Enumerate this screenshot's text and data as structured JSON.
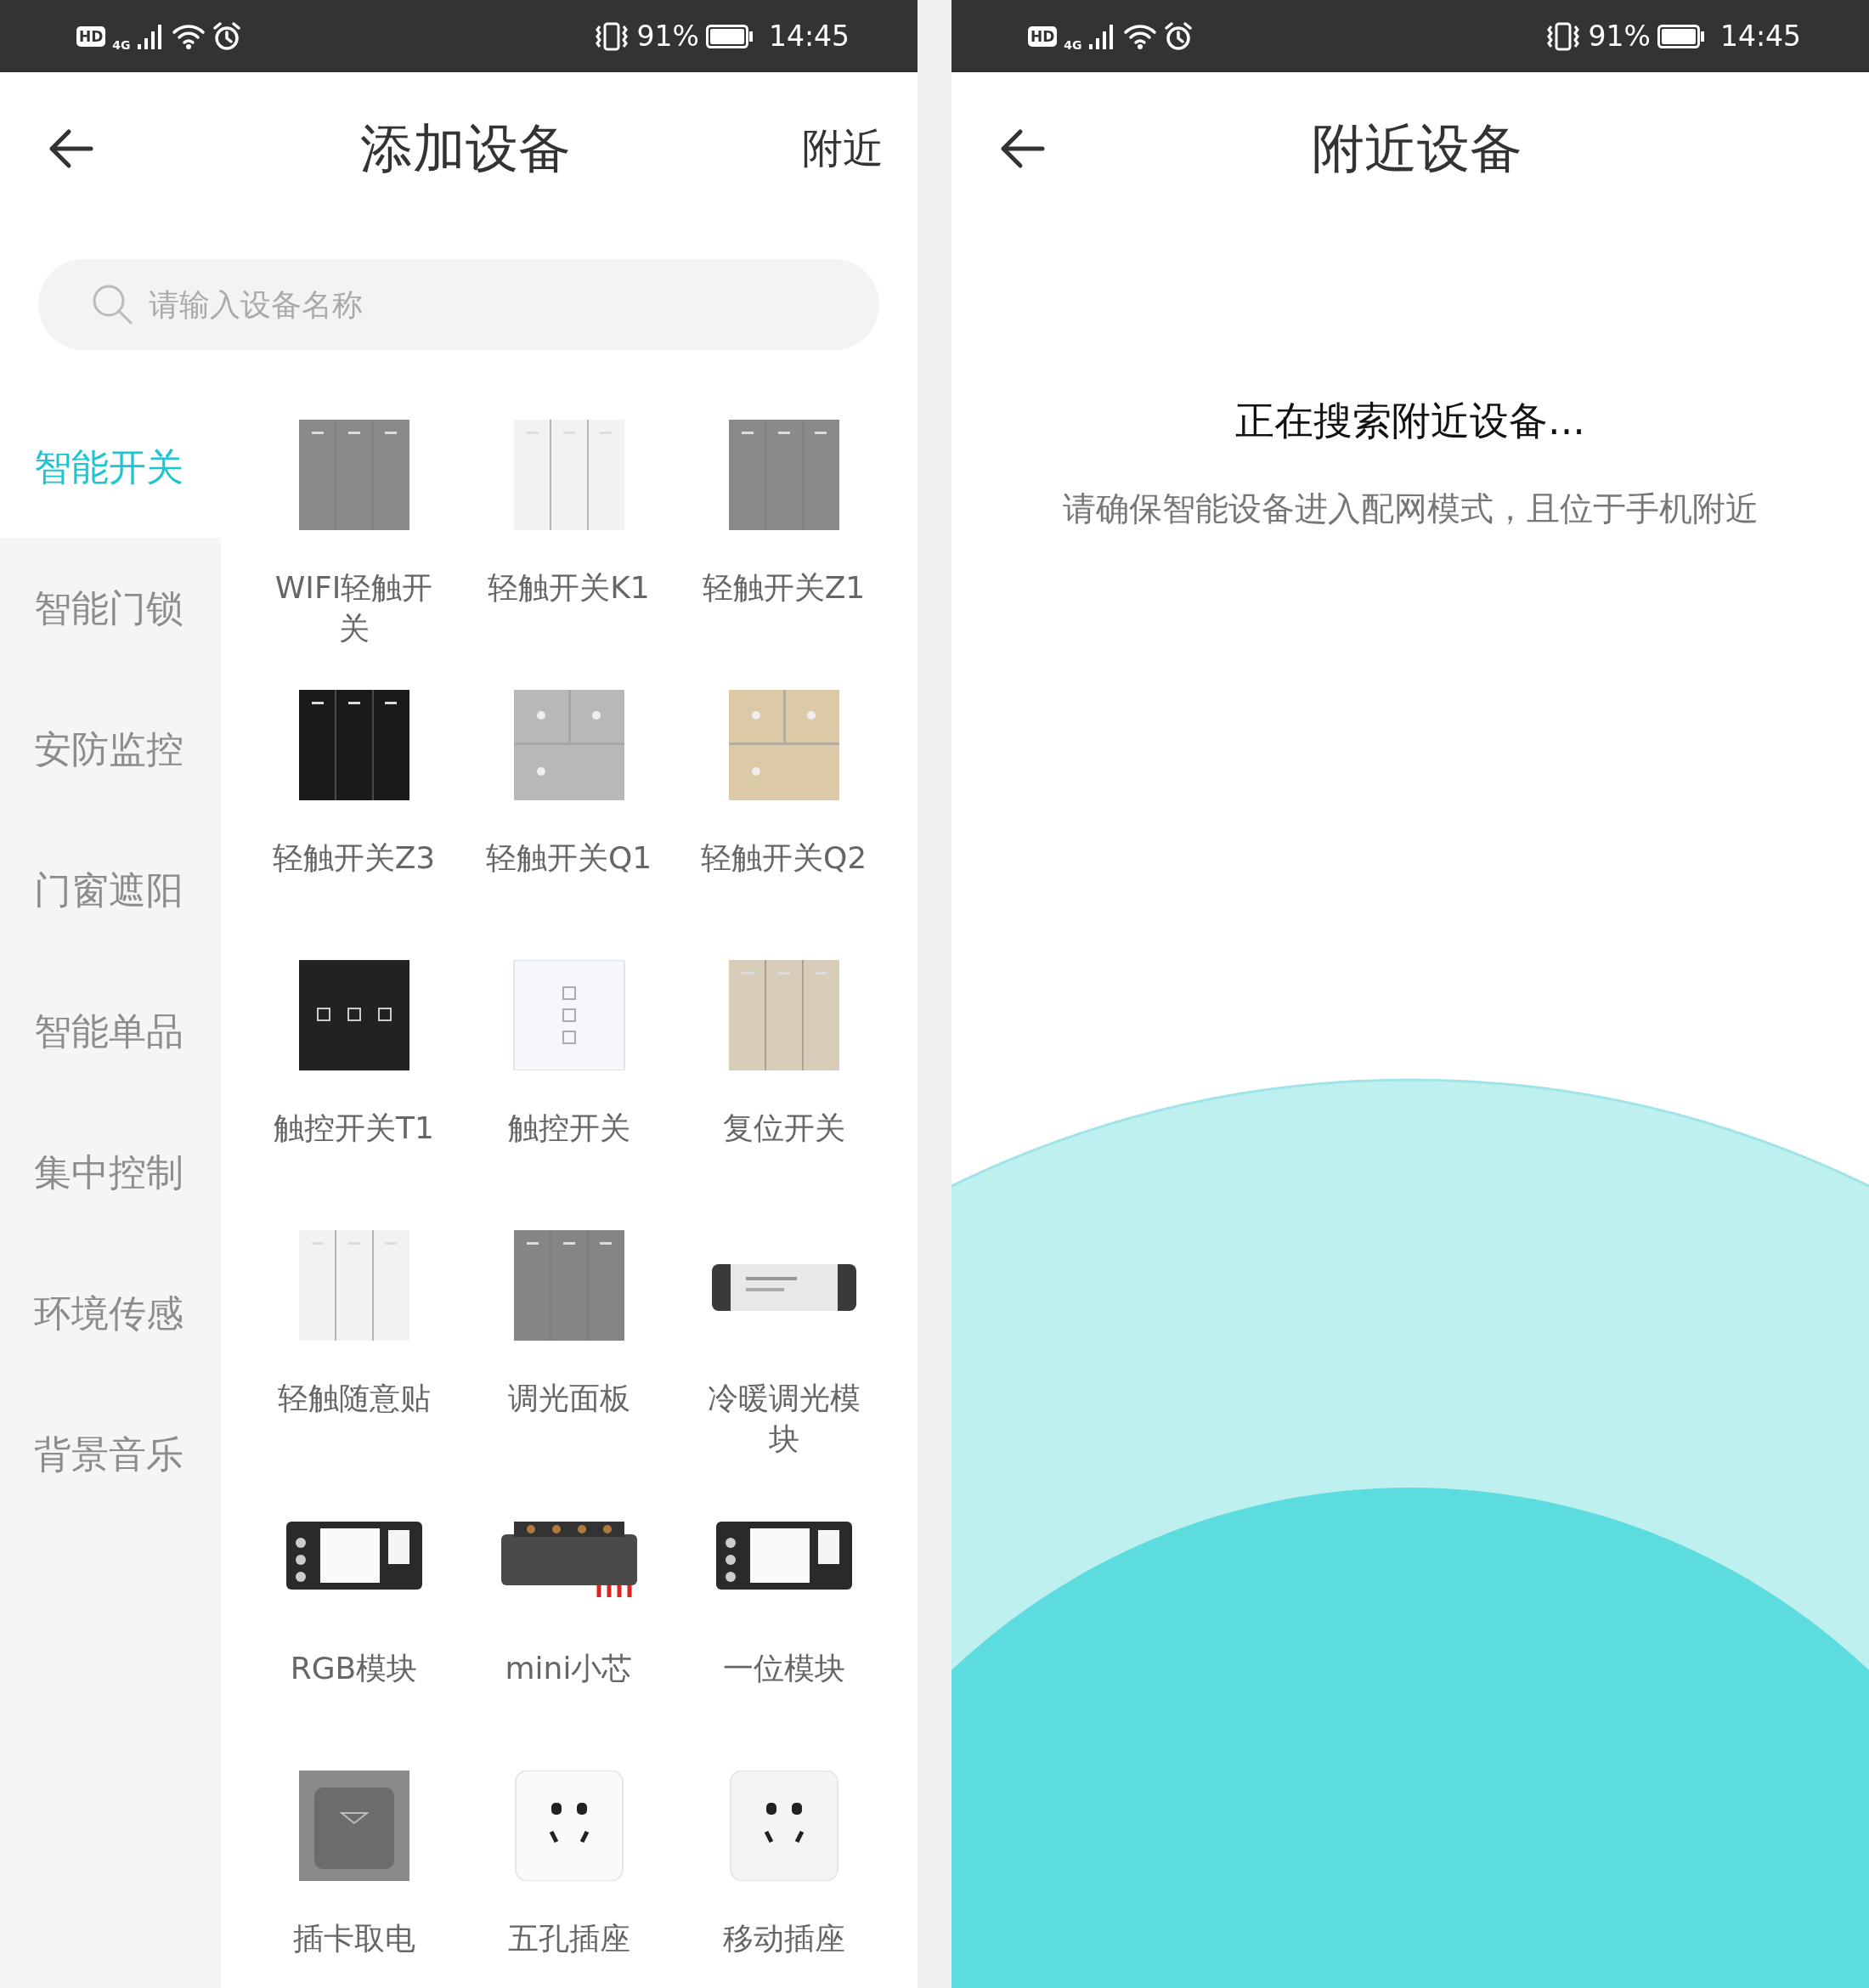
{
  "screens": [
    {
      "status_bar": {
        "hd": "HD",
        "network": "4G",
        "battery": "91%",
        "time": "14:45"
      },
      "header": {
        "title": "添加设备",
        "action": "附近"
      },
      "search": {
        "placeholder": "请输入设备名称"
      },
      "categories": [
        {
          "label": "智能开关",
          "selected": true
        },
        {
          "label": "智能门锁",
          "selected": false
        },
        {
          "label": "安防监控",
          "selected": false
        },
        {
          "label": "门窗遮阳",
          "selected": false
        },
        {
          "label": "智能单品",
          "selected": false
        },
        {
          "label": "集中控制",
          "selected": false
        },
        {
          "label": "环境传感",
          "selected": false
        },
        {
          "label": "背景音乐",
          "selected": false
        }
      ],
      "devices": [
        {
          "name": "WIFI轻触开关"
        },
        {
          "name": "轻触开关K1"
        },
        {
          "name": "轻触开关Z1"
        },
        {
          "name": "轻触开关Z3"
        },
        {
          "name": "轻触开关Q1"
        },
        {
          "name": "轻触开关Q2"
        },
        {
          "name": "触控开关T1"
        },
        {
          "name": "触控开关"
        },
        {
          "name": "复位开关"
        },
        {
          "name": "轻触随意贴"
        },
        {
          "name": "调光面板"
        },
        {
          "name": "冷暖调光模块"
        },
        {
          "name": "RGB模块"
        },
        {
          "name": "mini小芯"
        },
        {
          "name": "一位模块"
        },
        {
          "name": "插卡取电"
        },
        {
          "name": "五孔插座"
        },
        {
          "name": "移动插座"
        }
      ]
    },
    {
      "status_bar": {
        "hd": "HD",
        "network": "4G",
        "battery": "91%",
        "time": "14:45"
      },
      "header": {
        "title": "附近设备"
      },
      "searching": {
        "title": "正在搜索附近设备...",
        "hint": "请确保智能设备进入配网模式，且位于手机附近"
      }
    }
  ]
}
